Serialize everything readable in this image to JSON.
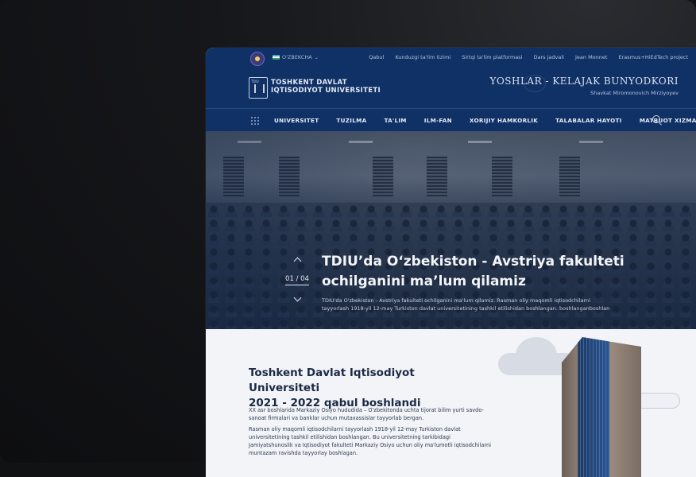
{
  "topbar": {
    "lang": "O'ZBEKCHA",
    "links": [
      "Qabul",
      "Kunduzgi ta'lim tizimi",
      "Sirtqi ta'lim platformasi",
      "Dars jadvali",
      "Jean Monnet",
      "Erasmus+HiEdTech project"
    ]
  },
  "header": {
    "logo_line1": "TOSHKENT  DAVLAT",
    "logo_line2": "IQTISODIYOT  UNIVERSITETI",
    "slogan": "YOSHLAR - KELAJAK BUNYODKORI",
    "slogan_author": "Shavkat Miromonovich Mirziyoyev"
  },
  "nav": {
    "items": [
      "UNIVERSITET",
      "TUZILMA",
      "TA'LIM",
      "ILM-FAN",
      "XORIJIY HAMKORLIK",
      "TALABALAR HAYOTI",
      "MATBUOT XIZMATI"
    ]
  },
  "hero": {
    "counter": "01 / 04",
    "title": "TDIU’da O‘zbekiston - Avstriya fakulteti ochilganini ma’lum qilamiz",
    "desc": "TDIU'da O'zbekiston - Avstriya fakulteti ochilganini ma'lum qilamiz. Rasman oliy maqomli iqtisodchilarni tayyorlash 1918-yil 12-may Turkiston davlat universitetining tashkil etilishidan boshlangan. boshlanganboshlan"
  },
  "section": {
    "title_line1": "Toshkent  Davlat Iqtisodiyot  Universiteti",
    "title_line2": "2021 - 2022 qabul boshlandi",
    "p1": "XX asr boshlarida Markaziy Osiyo hududida – O'zbekitonda uchta tijorat bilim yurti savdo-sanoat firmalari va banklar uchun mutaxassislar tayyorlab bergan.",
    "p2": "Rasman oliy maqomli iqtisodchilarni tayyorlash 1918-yil 12-may Turkiston davlat universitetining tashkil etilishidan boshlangan. Bu universitetning tarkibidagi Jamiyatshunoslik va Iqtisodiyot fakulteti Markaziy Osiyo uchun oliy ma'lumotli iqtisodchilarni muntazam ravishda tayyorlay boshlagan."
  }
}
